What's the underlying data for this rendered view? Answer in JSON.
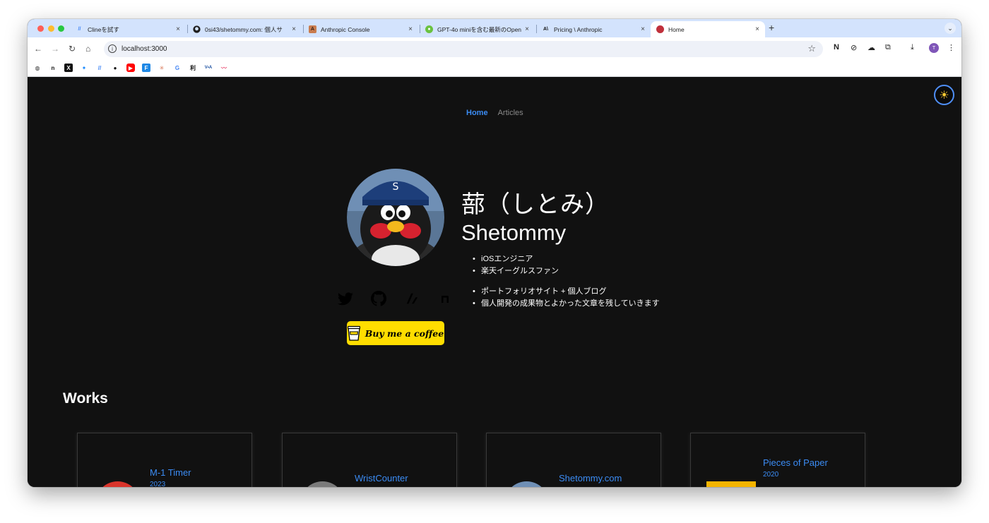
{
  "browser": {
    "tabs": [
      {
        "title": "Clineを試す",
        "icon": "cline-icon"
      },
      {
        "title": "0si43/shetommy.com: 個人サ",
        "icon": "github-icon"
      },
      {
        "title": "Anthropic Console",
        "icon": "anthropic-icon"
      },
      {
        "title": "GPT-4o miniを含む最新のOpen",
        "icon": "openai-icon"
      },
      {
        "title": "Pricing \\ Anthropic",
        "icon": "anthropic-icon"
      },
      {
        "title": "Home",
        "icon": "site-icon"
      }
    ],
    "url": "localhost:3000",
    "profile_initial": "T"
  },
  "page": {
    "nav": {
      "home": "Home",
      "articles": "Articles"
    },
    "profile": {
      "name_jp": "蔀（しとみ）",
      "name_en": "Shetommy",
      "bio": [
        "iOSエンジニア",
        "楽天イーグルスファン",
        "ポートフォリオサイト + 個人ブログ",
        "個人開発の成果物とよかった文章を残していきます"
      ]
    },
    "social": [
      "twitter-icon",
      "github-icon",
      "zenn-icon",
      "note-icon"
    ],
    "coffee_label": "Buy me a coffee",
    "works_title": "Works",
    "works": [
      {
        "title": "M-1 Timer",
        "year": "2023"
      },
      {
        "title": "WristCounter",
        "year": ""
      },
      {
        "title": "Shetommy.com",
        "year": ""
      },
      {
        "title": "Pieces of Paper",
        "year": "2020"
      }
    ],
    "colors": {
      "background": "#111111",
      "accent": "#3b8cf4",
      "coffee": "#ffdd00"
    }
  }
}
